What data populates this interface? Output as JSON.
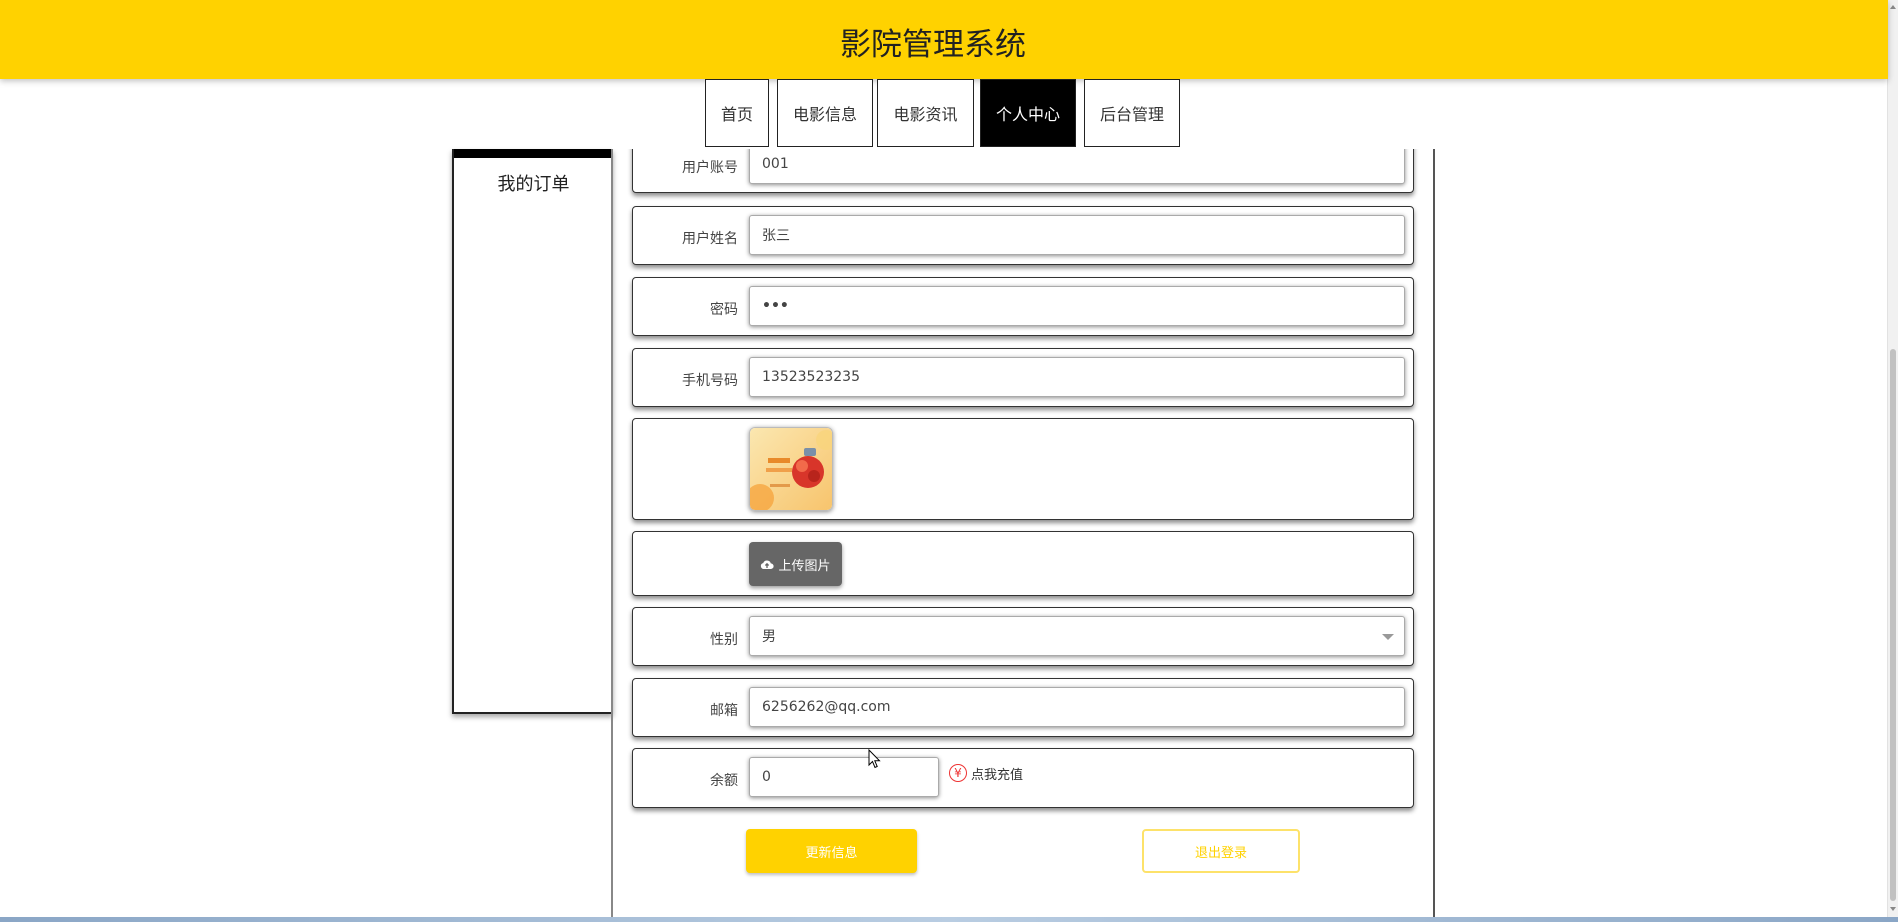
{
  "header": {
    "title": "影院管理系统",
    "bg_color": "#ffd200"
  },
  "nav": {
    "items": [
      {
        "label": "首页"
      },
      {
        "label": "电影信息"
      },
      {
        "label": "电影资讯"
      },
      {
        "label": "个人中心",
        "active": true
      },
      {
        "label": "后台管理"
      }
    ]
  },
  "sidebar": {
    "items": [
      {
        "label": "我的订单"
      }
    ]
  },
  "form": {
    "account": {
      "label": "用户账号",
      "value": "001"
    },
    "name": {
      "label": "用户姓名",
      "value": "张三"
    },
    "password": {
      "label": "密码",
      "value": "•••"
    },
    "phone": {
      "label": "手机号码",
      "value": "13523523235"
    },
    "avatar": {
      "alt": "avatar-image"
    },
    "upload": {
      "label": "上传图片",
      "icon": "cloud-upload-icon"
    },
    "gender": {
      "label": "性别",
      "value": "男"
    },
    "email": {
      "label": "邮箱",
      "value": "6256262@qq.com"
    },
    "balance": {
      "label": "余额",
      "value": "0",
      "recharge_label": "点我充值",
      "recharge_icon": "yen-icon"
    }
  },
  "actions": {
    "update_label": "更新信息",
    "logout_label": "退出登录",
    "accent_color": "#ffd200"
  }
}
